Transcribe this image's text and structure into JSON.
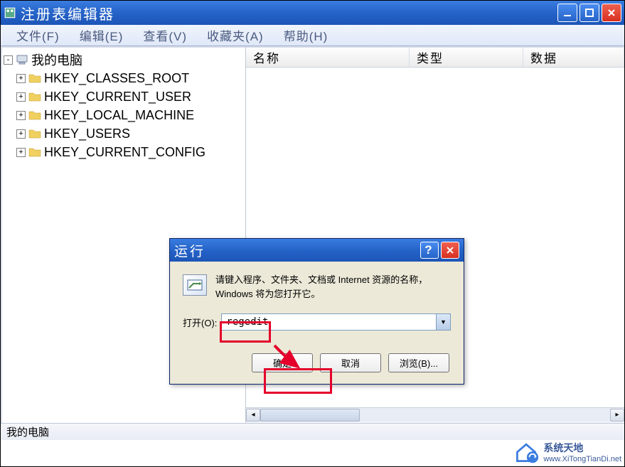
{
  "window": {
    "title": "注册表编辑器"
  },
  "menus": [
    "文件(F)",
    "编辑(E)",
    "查看(V)",
    "收藏夹(A)",
    "帮助(H)"
  ],
  "tree": {
    "root": {
      "label": "我的电脑",
      "expanded": true
    },
    "items": [
      {
        "label": "HKEY_CLASSES_ROOT"
      },
      {
        "label": "HKEY_CURRENT_USER"
      },
      {
        "label": "HKEY_LOCAL_MACHINE"
      },
      {
        "label": "HKEY_USERS"
      },
      {
        "label": "HKEY_CURRENT_CONFIG"
      }
    ]
  },
  "list": {
    "columns": [
      "名称",
      "类型",
      "数据"
    ]
  },
  "statusbar": "我的电脑",
  "run_dialog": {
    "title": "运行",
    "description": "请键入程序、文件夹、文档或 Internet 资源的名称，Windows 将为您打开它。",
    "open_label": "打开(O):",
    "input_value": "regedit",
    "buttons": {
      "ok": "确定",
      "cancel": "取消",
      "browse": "浏览(B)..."
    }
  },
  "watermark": {
    "name": "系统天地",
    "url": "www.XiTongTianDi.net"
  }
}
